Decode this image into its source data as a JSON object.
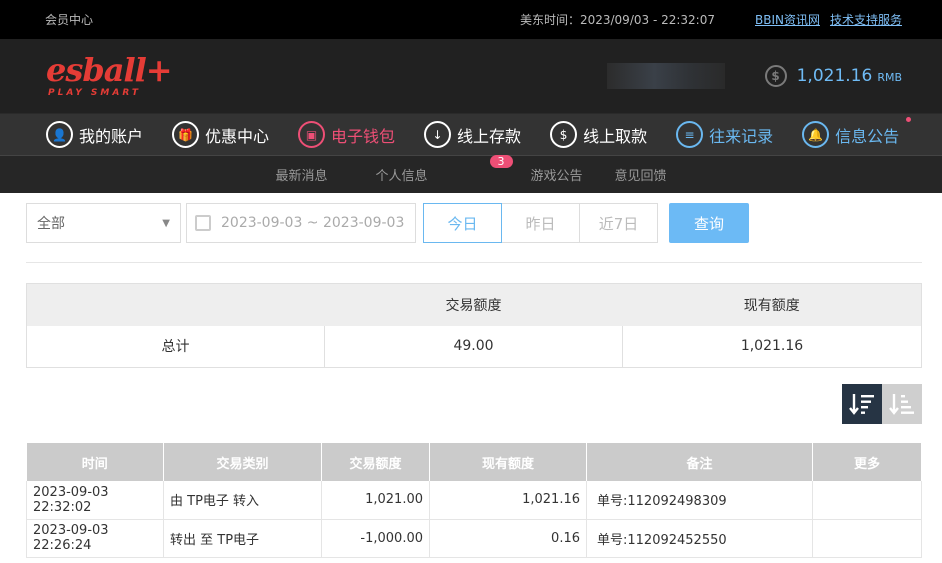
{
  "topbar": {
    "member_center": "会员中心",
    "time_label": "美东时间：2023/09/03 - 22:32:07",
    "link_news": "BBIN资讯网",
    "link_support": "技术支持服务"
  },
  "brand": {
    "logo_name": "esball+",
    "logo_tag": "PLAY SMART",
    "balance": "1,021.16",
    "currency": "RMB",
    "coin_icon": "dollar-coin-icon"
  },
  "nav": {
    "items": [
      {
        "label": "我的账户",
        "icon": "user-icon",
        "glyph": "👤"
      },
      {
        "label": "优惠中心",
        "icon": "gift-icon",
        "glyph": "🎁"
      },
      {
        "label": "电子钱包",
        "icon": "wallet-icon",
        "glyph": "▣"
      },
      {
        "label": "线上存款",
        "icon": "deposit-icon",
        "glyph": "↓"
      },
      {
        "label": "线上取款",
        "icon": "withdraw-icon",
        "glyph": "$"
      },
      {
        "label": "往来记录",
        "icon": "records-icon",
        "glyph": "≡"
      },
      {
        "label": "信息公告",
        "icon": "bell-icon",
        "glyph": "🔔"
      }
    ]
  },
  "subnav": {
    "items": [
      "最新消息",
      "个人信息",
      "游戏公告",
      "意见回馈"
    ],
    "badge": "3"
  },
  "filters": {
    "type_value": "全部",
    "date_range": "2023-09-03 ~ 2023-09-03",
    "today": "今日",
    "yesterday": "昨日",
    "last7": "近7日",
    "query": "查询"
  },
  "summary": {
    "col_amount": "交易额度",
    "col_balance": "现有额度",
    "row_label": "总计",
    "amount": "49.00",
    "balance": "1,021.16"
  },
  "records": {
    "headers": [
      "时间",
      "交易类别",
      "交易额度",
      "现有额度",
      "备注",
      "更多"
    ],
    "rows": [
      [
        "2023-09-03 22:32:02",
        "由 TP电子 转入",
        "1,021.00",
        "1,021.16",
        "单号:112092498309",
        ""
      ],
      [
        "2023-09-03 22:26:24",
        "转出 至 TP电子",
        "-1,000.00",
        "0.16",
        "单号:112092452550",
        ""
      ]
    ]
  }
}
